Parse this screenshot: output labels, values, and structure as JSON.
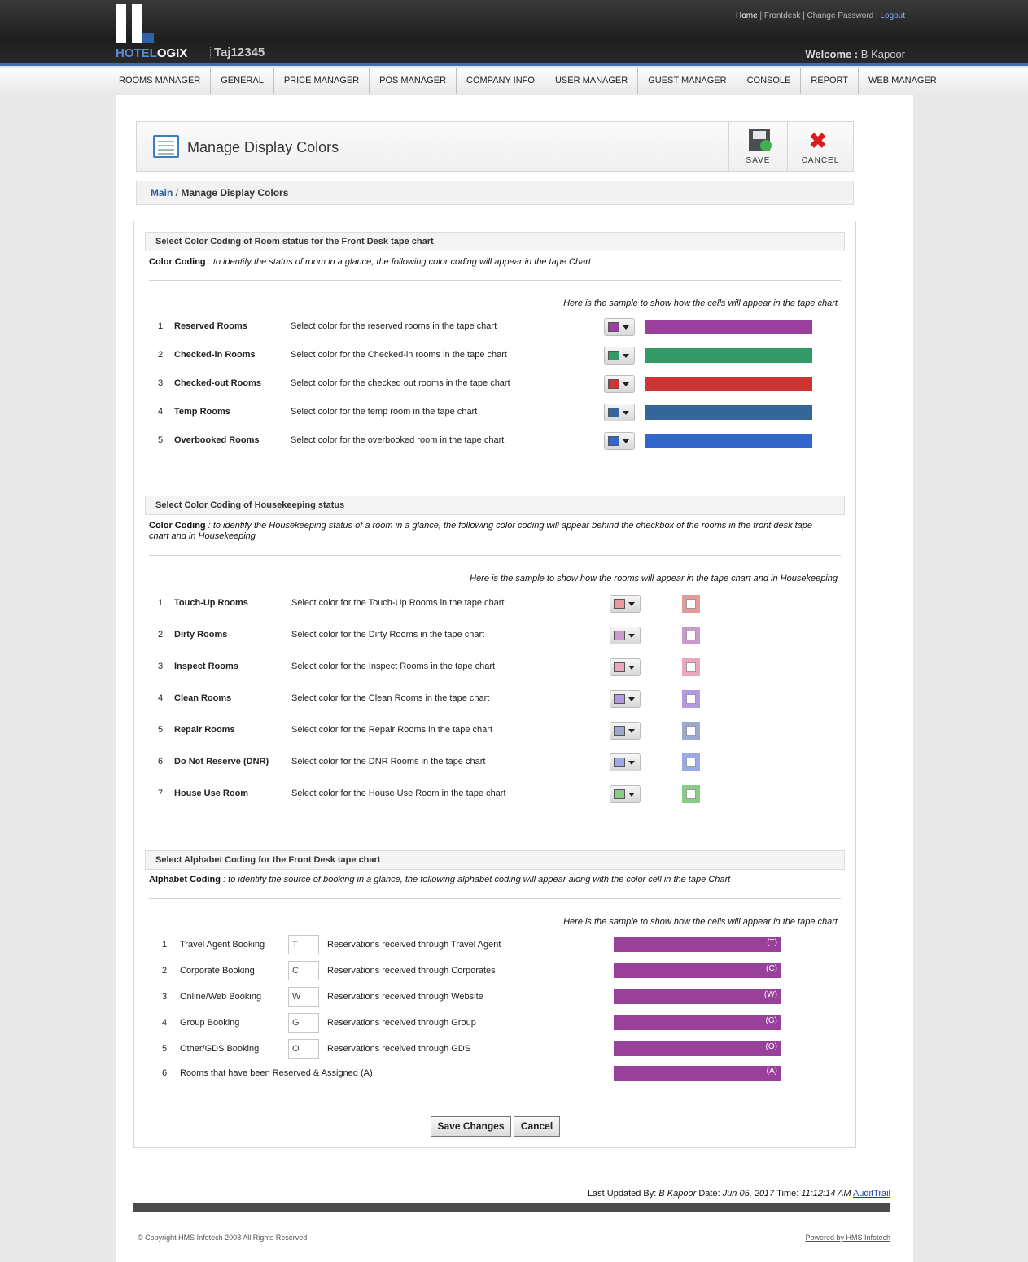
{
  "header": {
    "brand_a": "HOTEL",
    "brand_b": "OGIX",
    "property": "Taj12345",
    "links": {
      "home": "Home",
      "frontdesk": "Frontdesk",
      "change_password": "Change Password",
      "logout": "Logout",
      "sep": "|"
    },
    "welcome_label": "Welcome :",
    "welcome_user": "B Kapoor"
  },
  "nav": [
    "ROOMS MANAGER",
    "GENERAL",
    "PRICE MANAGER",
    "POS MANAGER",
    "COMPANY INFO",
    "USER MANAGER",
    "GUEST MANAGER",
    "CONSOLE",
    "REPORT",
    "WEB MANAGER"
  ],
  "page": {
    "title": "Manage Display Colors",
    "save_label": "SAVE",
    "cancel_label": "CANCEL",
    "breadcrumb_main": "Main",
    "breadcrumb_sep": " / ",
    "breadcrumb_current": "Manage Display Colors"
  },
  "room_status": {
    "heading": "Select Color Coding of Room status for the Front Desk tape chart",
    "desc_label": "Color Coding",
    "desc_text": " : to identify the status of room in a glance, the following color coding will appear in the tape Chart",
    "sample_note": "Here is the sample to show how the cells will appear in the tape chart",
    "rows": [
      {
        "num": "1",
        "name": "Reserved Rooms",
        "desc": "Select color for the reserved rooms in the tape chart",
        "color": "#9b3f9d"
      },
      {
        "num": "2",
        "name": "Checked-in Rooms",
        "desc": "Select color for the Checked-in rooms in the tape chart",
        "color": "#339966"
      },
      {
        "num": "3",
        "name": "Checked-out Rooms",
        "desc": "Select color for the checked out rooms in the tape chart",
        "color": "#cc3333"
      },
      {
        "num": "4",
        "name": "Temp Rooms",
        "desc": "Select color for the temp room in the tape chart",
        "color": "#336699"
      },
      {
        "num": "5",
        "name": "Overbooked Rooms",
        "desc": "Select color for the overbooked room in the tape chart",
        "color": "#3366cc"
      }
    ]
  },
  "housekeeping": {
    "heading": "Select Color Coding of Housekeeping status",
    "desc_label": "Color Coding",
    "desc_text": " : to identify the Housekeeping status of a room in a glance, the following color coding will appear behind the checkbox of the rooms in the front desk tape chart and in Housekeeping",
    "sample_note": "Here is the sample to show how the rooms will appear in the tape chart and in Housekeeping",
    "rows": [
      {
        "num": "1",
        "name": "Touch-Up Rooms",
        "desc": "Select color for the Touch-Up Rooms in the tape chart",
        "color": "#e69999"
      },
      {
        "num": "2",
        "name": "Dirty Rooms",
        "desc": "Select color for the Dirty Rooms in the tape chart",
        "color": "#cc99cc"
      },
      {
        "num": "3",
        "name": "Inspect Rooms",
        "desc": "Select color for the Inspect Rooms in the tape chart",
        "color": "#eea6bf"
      },
      {
        "num": "4",
        "name": "Clean Rooms",
        "desc": "Select color for the Clean Rooms in the tape chart",
        "color": "#b399e0"
      },
      {
        "num": "5",
        "name": "Repair Rooms",
        "desc": "Select color for the Repair Rooms in the tape chart",
        "color": "#99aacc"
      },
      {
        "num": "6",
        "name": "Do Not Reserve (DNR)",
        "desc": "Select color for the DNR Rooms in the tape chart",
        "color": "#99aae6"
      },
      {
        "num": "7",
        "name": "House Use Room",
        "desc": "Select color for the House Use Room in the tape chart",
        "color": "#88cc88"
      }
    ]
  },
  "alphabet": {
    "heading": "Select Alphabet Coding for the Front Desk tape chart",
    "desc_label": "Alphabet Coding",
    "desc_text": " : to identify the source of booking in a glance, the following alphabet coding will appear along with the color cell in the tape Chart",
    "sample_note": "Here is the sample to show how the cells will appear in the tape chart",
    "rows": [
      {
        "num": "1",
        "name": "Travel Agent Booking",
        "code": "T",
        "desc": "Reservations received through Travel Agent",
        "sample": "(T)"
      },
      {
        "num": "2",
        "name": "Corporate Booking",
        "code": "C",
        "desc": "Reservations received through Corporates",
        "sample": "(C)"
      },
      {
        "num": "3",
        "name": "Online/Web Booking",
        "code": "W",
        "desc": "Reservations received through Website",
        "sample": "(W)"
      },
      {
        "num": "4",
        "name": "Group Booking",
        "code": "G",
        "desc": "Reservations received through Group",
        "sample": "(G)"
      },
      {
        "num": "5",
        "name": "Other/GDS Booking",
        "code": "O",
        "desc": "Reservations received through GDS",
        "sample": "(O)"
      },
      {
        "num": "6",
        "name": "Rooms that have been Reserved & Assigned (A)",
        "sample": "(A)"
      }
    ]
  },
  "actions": {
    "save_changes": "Save Changes",
    "cancel": "Cancel"
  },
  "footer": {
    "last_updated_label": "Last Updated By:",
    "last_updated_user": "B Kapoor",
    "date_label": "Date:",
    "date_value": "Jun 05, 2017",
    "time_label": "Time:",
    "time_value": "11:12:14 AM",
    "audit_link": "AuditTrail",
    "copyright": "© Copyright HMS Infotech 2008 All Rights Reserved",
    "powered": "Powered by HMS Infotech"
  }
}
